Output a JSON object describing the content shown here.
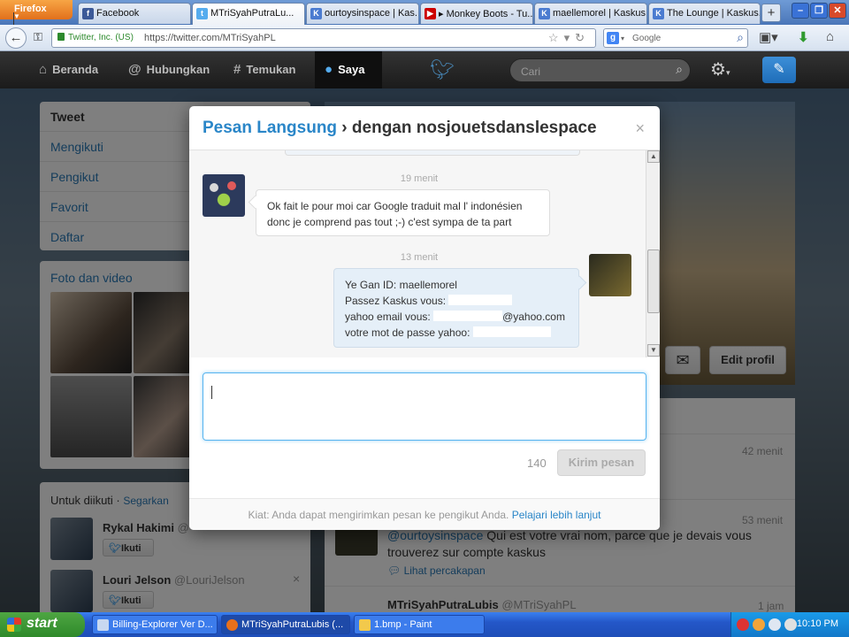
{
  "browser": {
    "app_button": "Firefox",
    "tabs": [
      {
        "label": "Facebook",
        "icon": "facebook-icon",
        "color": "#3b5998",
        "active": false
      },
      {
        "label": "MTriSyahPutraLu...",
        "icon": "twitter-icon",
        "color": "#55acee",
        "active": true
      },
      {
        "label": "ourtoysinspace | Kas...",
        "icon": "kaskus-icon",
        "color": "#4a7bd0",
        "active": false
      },
      {
        "label": "▸ Monkey Boots - Tu...",
        "icon": "youtube-icon",
        "color": "#cc0000",
        "active": false
      },
      {
        "label": "maellemorel | Kaskus...",
        "icon": "kaskus-icon",
        "color": "#4a7bd0",
        "active": false
      },
      {
        "label": "The Lounge | Kaskus...",
        "icon": "kaskus-icon",
        "color": "#4a7bd0",
        "active": false
      }
    ],
    "identity": "Twitter, Inc. (US)",
    "url": "https://twitter.com/MTriSyahPL",
    "search_engine_placeholder": "Google"
  },
  "twitter_nav": {
    "items": [
      {
        "label": "Beranda",
        "icon": "home-icon"
      },
      {
        "label": "Hubungkan",
        "icon": "at-icon"
      },
      {
        "label": "Temukan",
        "icon": "hash-icon"
      },
      {
        "label": "Saya",
        "icon": "user-icon"
      }
    ],
    "search_placeholder": "Cari"
  },
  "sidebar": {
    "menu": [
      "Tweet",
      "Mengikuti",
      "Pengikut",
      "Favorit",
      "Daftar"
    ],
    "photos_title": "Foto dan video",
    "who_to_follow_title": "Untuk diikuti",
    "refresh_link": "Segarkan",
    "follow_button": "Ikuti",
    "suggestions": [
      {
        "name": "Rykal Hakimi",
        "handle": "@"
      },
      {
        "name": "Louri Jelson",
        "handle": "@LouriJelson"
      }
    ]
  },
  "profile": {
    "edit_button": "Edit profil"
  },
  "stream": {
    "tweets": [
      {
        "time": "42 menit"
      },
      {
        "time": "53 menit",
        "mention": "@ourtoysinspace",
        "text": " Qui est votre vrai nom, parce que je devais vous trouverez sur compte kaskus",
        "link": "Lihat percakapan"
      },
      {
        "time": "1 jam",
        "name": "MTriSyahPutraLubis",
        "handle": "@MTriSyahPL"
      }
    ]
  },
  "dm_modal": {
    "title_link": "Pesan Langsung",
    "title_rest": " › dengan nosjouetsdanslespace",
    "close": "×",
    "messages": [
      {
        "time": "19 menit",
        "direction": "in",
        "lines": [
          "Ok fait le pour moi car Google traduit mal l' indonésien",
          "donc je comprend pas tout ;-) c'est sympa de ta part"
        ]
      },
      {
        "time": "13 menit",
        "direction": "out",
        "lines": [
          "Ye Gan ID: maellemorel",
          "Passez Kaskus vous:",
          "yahoo email vous:",
          "votre mot de passe yahoo:"
        ],
        "email_suffix": "@yahoo.com"
      }
    ],
    "char_count": "140",
    "send_button": "Kirim pesan",
    "footer_tip": "Kiat: Anda dapat mengirimkan pesan ke pengikut Anda.",
    "footer_link": "Pelajari lebih lanjut"
  },
  "taskbar": {
    "start": "start",
    "tasks": [
      {
        "label": "Billing-Explorer Ver D...",
        "active": false
      },
      {
        "label": "MTriSyahPutraLubis (...",
        "active": true
      },
      {
        "label": "1.bmp - Paint",
        "active": false
      }
    ],
    "clock": "10:10 PM"
  }
}
